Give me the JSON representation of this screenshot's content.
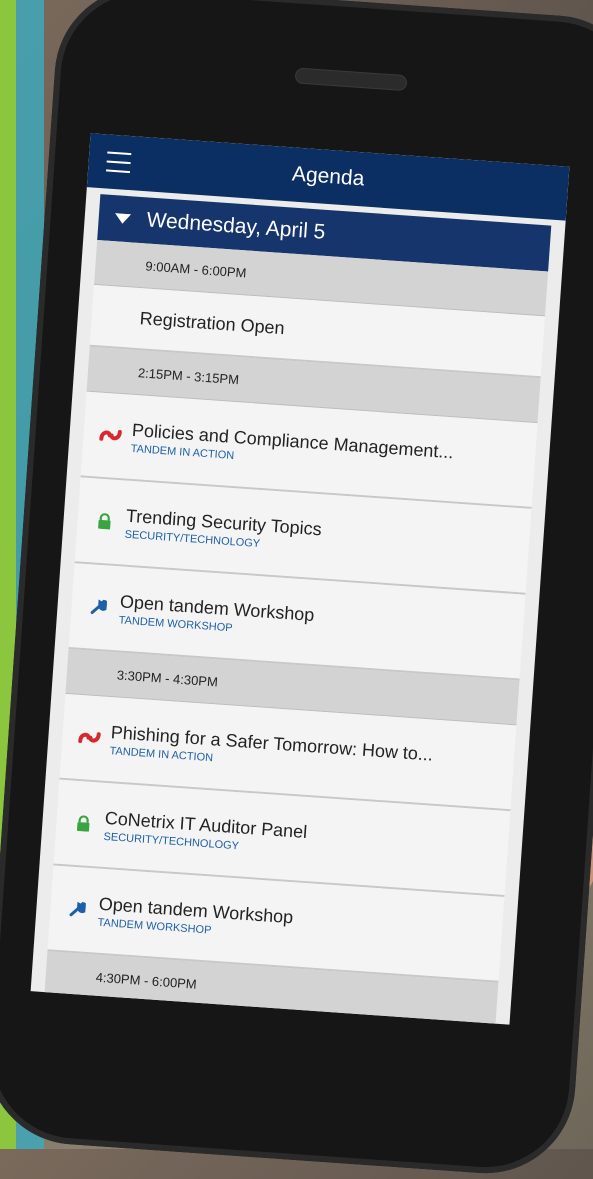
{
  "app": {
    "title": "Agenda"
  },
  "day": {
    "label": "Wednesday, April 5"
  },
  "colors": {
    "navy": "#0b2f63",
    "accent_blue": "#1d5fa8",
    "icon_red": "#d7282f",
    "icon_green": "#3aa540"
  },
  "schedule": [
    {
      "time": "9:00AM - 6:00PM",
      "items": [
        {
          "title": "Registration Open",
          "category": "",
          "icon": "none"
        }
      ]
    },
    {
      "time": "2:15PM - 3:15PM",
      "items": [
        {
          "title": "Policies and Compliance Management...",
          "category": "TANDEM IN ACTION",
          "icon": "tandem-icon"
        },
        {
          "title": "Trending Security Topics",
          "category": "SECURITY/TECHNOLOGY",
          "icon": "lock-icon"
        },
        {
          "title": "Open tandem Workshop",
          "category": "TANDEM WORKSHOP",
          "icon": "wrench-icon"
        }
      ]
    },
    {
      "time": "3:30PM - 4:30PM",
      "items": [
        {
          "title": "Phishing for a Safer Tomorrow: How to...",
          "category": "TANDEM IN ACTION",
          "icon": "tandem-icon"
        },
        {
          "title": "CoNetrix IT Auditor Panel",
          "category": "SECURITY/TECHNOLOGY",
          "icon": "lock-icon"
        },
        {
          "title": "Open tandem Workshop",
          "category": "TANDEM WORKSHOP",
          "icon": "wrench-icon"
        }
      ]
    },
    {
      "time": "4:30PM - 6:00PM",
      "items": []
    }
  ]
}
